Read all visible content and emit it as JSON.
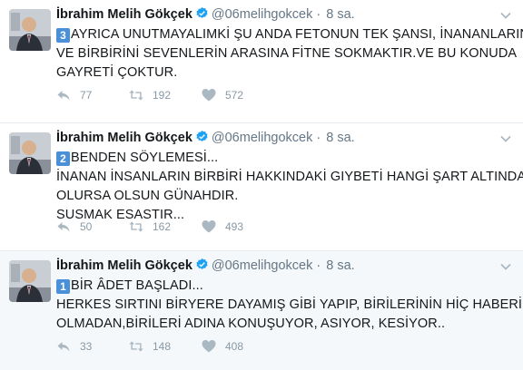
{
  "tweets": [
    {
      "name": "İbrahim Melih Gökçek",
      "handle": "@06melihgokcek",
      "time": "8 sa.",
      "badge": "3",
      "lines": [
        "AYRICA UNUTMAYALIMKİ ŞU ANDA FETONUN TEK ŞANSI, İNANANLARIN",
        "VE BİRBİRİNİ SEVENLERİN ARASINA FİTNE SOKMAKTIR.VE BU KONUDA",
        "GAYRETİ ÇOKTUR."
      ],
      "replies": "77",
      "retweets": "192",
      "likes": "572"
    },
    {
      "name": "İbrahim Melih Gökçek",
      "handle": "@06melihgokcek",
      "time": "8 sa.",
      "badge": "2",
      "lines": [
        "BENDEN SÖYLEMESİ...",
        "İNANAN İNSANLARIN BİRBİRİ HAKKINDAKİ GIYBETİ HANGİ ŞART ALTINDA",
        "OLURSA OLSUN GÜNAHDIR.",
        "SUSMAK ESASTIR..."
      ],
      "replies": "50",
      "retweets": "162",
      "likes": "493"
    },
    {
      "name": "İbrahim Melih Gökçek",
      "handle": "@06melihgokcek",
      "time": "8 sa.",
      "badge": "1",
      "lines": [
        "BİR ÂDET BAŞLADI...",
        "HERKES SIRTINI BİRYERE DAYAMIŞ GİBİ YAPIP, BİRİLERİNİN HİÇ HABERİ",
        "OLMADAN,BİRİLERİ ADINA KONUŞUYOR, ASIYOR, KESİYOR.."
      ],
      "replies": "33",
      "retweets": "148",
      "likes": "408"
    }
  ],
  "icons": {
    "reply": "reply-icon",
    "retweet": "retweet-icon",
    "like": "heart-icon",
    "verified": "verified-badge-icon",
    "menu": "chevron-down-icon"
  },
  "colors": {
    "verified": "#1da1f2",
    "badge": "#4a90d9",
    "muted": "#657786",
    "highlight_bg": "#f5f8fa"
  }
}
